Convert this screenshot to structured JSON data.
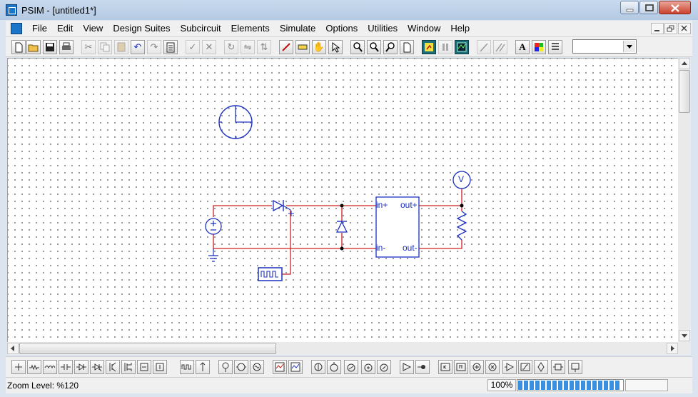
{
  "window": {
    "title": "PSIM - [untitled1*]"
  },
  "menu": {
    "items": [
      "File",
      "Edit",
      "View",
      "Design Suites",
      "Subcircuit",
      "Elements",
      "Simulate",
      "Options",
      "Utilities",
      "Window",
      "Help"
    ]
  },
  "toolbar": {
    "style_combo_value": ""
  },
  "circuit": {
    "meter_label": "V",
    "subcircuit_ports": {
      "in_plus": "in+",
      "in_minus": "in-",
      "out_plus": "out+",
      "out_minus": "out-"
    },
    "colors": {
      "wire": "#d02020",
      "component": "#1a2fbf"
    }
  },
  "status": {
    "zoom_text": "Zoom Level: %120",
    "zoom_percent": "100%",
    "progress_fraction": 0.98
  }
}
